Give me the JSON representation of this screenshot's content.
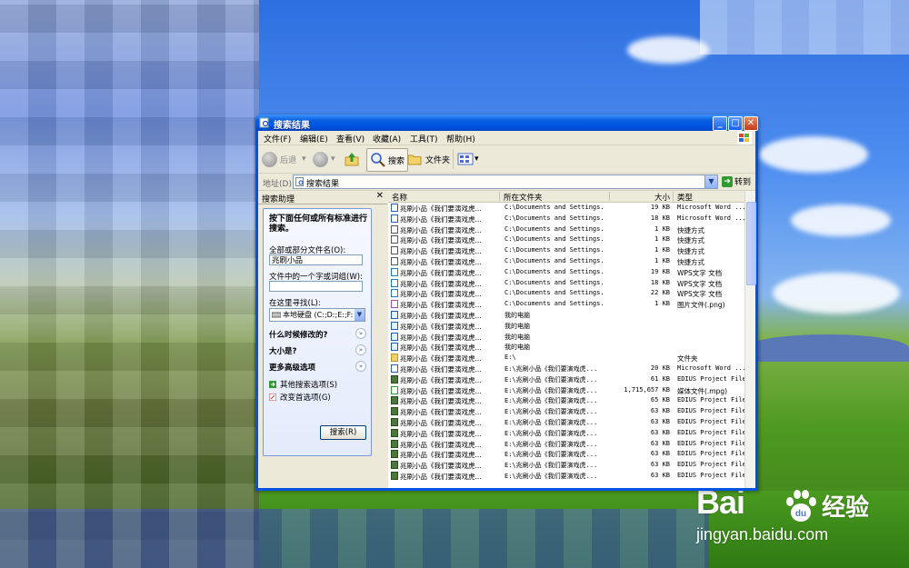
{
  "window": {
    "title": "搜索结果",
    "controls": {
      "minimize": "_",
      "maximize": "□",
      "close": "✕"
    }
  },
  "menu": [
    "文件(F)",
    "编辑(E)",
    "查看(V)",
    "收藏(A)",
    "工具(T)",
    "帮助(H)"
  ],
  "toolbar": {
    "back": "后退",
    "search": "搜索",
    "folders": "文件夹"
  },
  "address": {
    "label": "地址(D)",
    "value": "搜索结果",
    "go": "转到"
  },
  "search_pane": {
    "title": "搜索助理",
    "close": "✕",
    "heading": "按下面任何或所有标准进行搜索。",
    "filename_label": "全部或部分文件名(O):",
    "filename_value": "兆刷小品",
    "phrase_label": "文件中的一个字或词组(W):",
    "phrase_value": "",
    "lookin_label": "在这里寻找(L):",
    "lookin_value": "本地硬盘 (C:;D:;E:;F:",
    "sections": [
      "什么时候修改的?",
      "大小是?",
      "更多高级选项"
    ],
    "links": [
      "其他搜索选项(S)",
      "改变首选项(G)"
    ],
    "search_button": "搜索(R)"
  },
  "list": {
    "columns": [
      "名称",
      "所在文件夹",
      "大小",
      "类型"
    ],
    "rows": [
      {
        "icon": "word-doc-icon",
        "name": "兆刷小品《我们要演戏虎...",
        "folder": "C:\\Documents and Settings...",
        "size": "19 KB",
        "type": "Microsoft Word ..."
      },
      {
        "icon": "word-doc-icon",
        "name": "兆刷小品《我们要演戏虎...",
        "folder": "C:\\Documents and Settings...",
        "size": "18 KB",
        "type": "Microsoft Word ..."
      },
      {
        "icon": "shortcut-icon",
        "name": "兆刷小品《我们要演戏虎...",
        "folder": "C:\\Documents and Settings...",
        "size": "1 KB",
        "type": "快捷方式"
      },
      {
        "icon": "shortcut-icon",
        "name": "兆刷小品《我们要演戏虎...",
        "folder": "C:\\Documents and Settings...",
        "size": "1 KB",
        "type": "快捷方式"
      },
      {
        "icon": "shortcut-icon",
        "name": "兆刷小品《我们要演戏虎...",
        "folder": "C:\\Documents and Settings...",
        "size": "1 KB",
        "type": "快捷方式"
      },
      {
        "icon": "shortcut-icon",
        "name": "兆刷小品《我们要演戏虎...",
        "folder": "C:\\Documents and Settings...",
        "size": "1 KB",
        "type": "快捷方式"
      },
      {
        "icon": "wps-doc-icon",
        "name": "兆刷小品《我们要演戏虎...",
        "folder": "C:\\Documents and Settings...",
        "size": "19 KB",
        "type": "WPS文字 文档"
      },
      {
        "icon": "wps-doc-icon",
        "name": "兆刷小品《我们要演戏虎...",
        "folder": "C:\\Documents and Settings...",
        "size": "18 KB",
        "type": "WPS文字 文档"
      },
      {
        "icon": "wps-doc-icon",
        "name": "兆刷小品《我们要演戏虎...",
        "folder": "C:\\Documents and Settings...",
        "size": "22 KB",
        "type": "WPS文字 文档"
      },
      {
        "icon": "image-file-icon",
        "name": "兆刷小品《我们要演戏虎...",
        "folder": "C:\\Documents and Settings...",
        "size": "1 KB",
        "type": "图片文件(.png)"
      },
      {
        "icon": "ie-link-icon",
        "name": "兆刷小品《我们要演戏虎...",
        "folder": "我的电脑",
        "size": "",
        "type": ""
      },
      {
        "icon": "ie-link-icon",
        "name": "兆刷小品《我们要演戏虎...",
        "folder": "我的电脑",
        "size": "",
        "type": ""
      },
      {
        "icon": "ie-link-icon",
        "name": "兆刷小品《我们要演戏虎...",
        "folder": "我的电脑",
        "size": "",
        "type": ""
      },
      {
        "icon": "ie-link-icon",
        "name": "兆刷小品《我们要演戏虎...",
        "folder": "我的电脑",
        "size": "",
        "type": ""
      },
      {
        "icon": "folder-icon",
        "name": "兆刷小品《我们要演戏虎...",
        "folder": "E:\\",
        "size": "",
        "type": "文件夹"
      },
      {
        "icon": "word-doc-icon",
        "name": "兆刷小品《我们要演戏虎...",
        "folder": "E:\\兆刷小品《我们要演戏虎...",
        "size": "20 KB",
        "type": "Microsoft Word ..."
      },
      {
        "icon": "edius-project-icon",
        "name": "兆刷小品《我们要演戏虎...",
        "folder": "E:\\兆刷小品《我们要演戏虎...",
        "size": "61 KB",
        "type": "EDIUS Project File"
      },
      {
        "icon": "media-file-icon",
        "name": "兆刷小品《我们要演戏虎...",
        "folder": "E:\\兆刷小品《我们要演戏虎...",
        "size": "1,715,657 KB",
        "type": "媒体文件(.mpg)"
      },
      {
        "icon": "edius-project-icon",
        "name": "兆刷小品《我们要演戏虎...",
        "folder": "E:\\兆刷小品《我们要演戏虎...",
        "size": "65 KB",
        "type": "EDIUS Project File"
      },
      {
        "icon": "edius-project-icon",
        "name": "兆刷小品《我们要演戏虎...",
        "folder": "E:\\兆刷小品《我们要演戏虎...",
        "size": "63 KB",
        "type": "EDIUS Project File"
      },
      {
        "icon": "edius-project-icon",
        "name": "兆刷小品《我们要演戏虎...",
        "folder": "E:\\兆刷小品《我们要演戏虎...",
        "size": "63 KB",
        "type": "EDIUS Project File"
      },
      {
        "icon": "edius-project-icon",
        "name": "兆刷小品《我们要演戏虎...",
        "folder": "E:\\兆刷小品《我们要演戏虎...",
        "size": "63 KB",
        "type": "EDIUS Project File"
      },
      {
        "icon": "edius-project-icon",
        "name": "兆刷小品《我们要演戏虎...",
        "folder": "E:\\兆刷小品《我们要演戏虎...",
        "size": "63 KB",
        "type": "EDIUS Project File"
      },
      {
        "icon": "edius-project-icon",
        "name": "兆刷小品《我们要演戏虎...",
        "folder": "E:\\兆刷小品《我们要演戏虎...",
        "size": "63 KB",
        "type": "EDIUS Project File"
      },
      {
        "icon": "edius-project-icon",
        "name": "兆刷小品《我们要演戏虎...",
        "folder": "E:\\兆刷小品《我们要演戏虎...",
        "size": "63 KB",
        "type": "EDIUS Project File"
      },
      {
        "icon": "edius-project-icon",
        "name": "兆刷小品《我们要演戏虎...",
        "folder": "E:\\兆刷小品《我们要演戏虎...",
        "size": "63 KB",
        "type": "EDIUS Project File"
      }
    ]
  },
  "watermark": {
    "brand": "Bai",
    "brand_suffix": "经验",
    "url": "jingyan.baidu.com"
  }
}
